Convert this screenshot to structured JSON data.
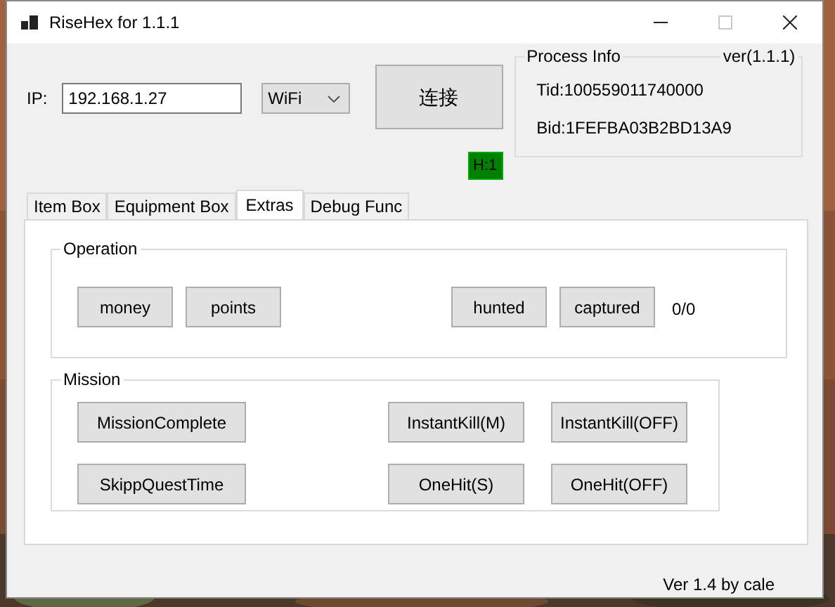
{
  "window": {
    "title": "RiseHex for 1.1.1",
    "controls": [
      {
        "kind": "minimize",
        "disabled": false
      },
      {
        "kind": "maximize",
        "disabled": true
      },
      {
        "kind": "close",
        "disabled": false
      }
    ]
  },
  "connection": {
    "ip_label": "IP:",
    "ip_value": "192.168.1.27",
    "mode": "WiFi",
    "connect_button": "连接",
    "status_badge": "H:1"
  },
  "process_info": {
    "title": "Process Info",
    "version": "ver(1.1.1)",
    "tid": "Tid:100559011740000",
    "bid": "Bid:1FEFBA03B2BD13A9"
  },
  "tabs": [
    {
      "label": "Item Box",
      "selected": false
    },
    {
      "label": "Equipment Box",
      "selected": false
    },
    {
      "label": "Extras",
      "selected": true
    },
    {
      "label": "Debug Func",
      "selected": false
    }
  ],
  "operation": {
    "title": "Operation",
    "left_buttons": [
      "money",
      "points"
    ],
    "right_buttons": [
      "hunted",
      "captured"
    ],
    "count": "0/0"
  },
  "mission": {
    "title": "Mission",
    "rows": [
      {
        "left": "MissionComplete",
        "right": [
          "InstantKill(M)",
          "InstantKill(OFF)"
        ]
      },
      {
        "left": "SkippQuestTime",
        "right": [
          "OneHit(S)",
          "OneHit(OFF)"
        ]
      }
    ]
  },
  "footer": "Ver 1.4 by cale"
}
